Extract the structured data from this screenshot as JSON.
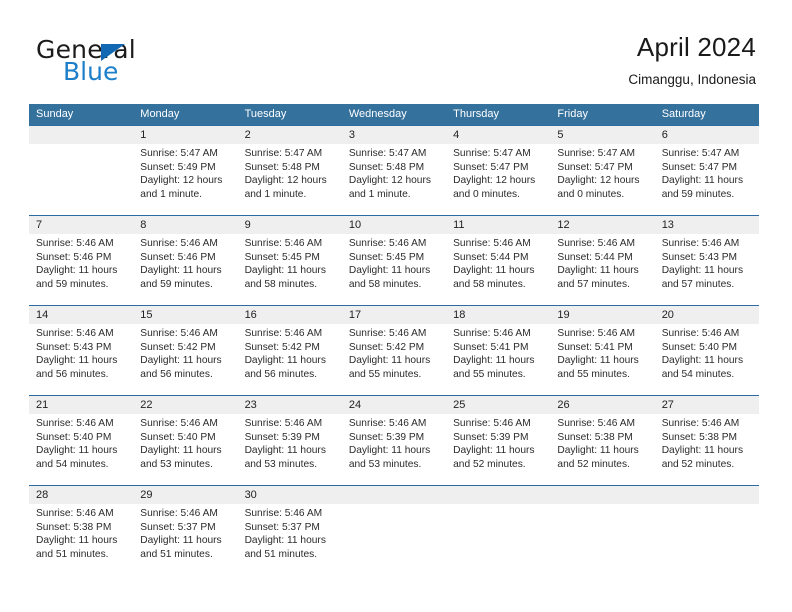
{
  "brand": {
    "word_general": "General",
    "word_blue": "Blue",
    "logo_icon": "triangle-logo-icon",
    "accent_color": "#1d7fc9"
  },
  "header": {
    "title": "April 2024",
    "subtitle": "Cimanggu, Indonesia"
  },
  "theme": {
    "header_bg": "#35719d",
    "row_divider": "#2d6ca2",
    "daynum_band": "#efefef"
  },
  "weekdays": [
    "Sunday",
    "Monday",
    "Tuesday",
    "Wednesday",
    "Thursday",
    "Friday",
    "Saturday"
  ],
  "weeks": [
    {
      "days": [
        {
          "num": "",
          "l1": "",
          "l2": "",
          "l3": "",
          "l4": ""
        },
        {
          "num": "1",
          "l1": "Sunrise: 5:47 AM",
          "l2": "Sunset: 5:49 PM",
          "l3": "Daylight: 12 hours",
          "l4": "and 1 minute."
        },
        {
          "num": "2",
          "l1": "Sunrise: 5:47 AM",
          "l2": "Sunset: 5:48 PM",
          "l3": "Daylight: 12 hours",
          "l4": "and 1 minute."
        },
        {
          "num": "3",
          "l1": "Sunrise: 5:47 AM",
          "l2": "Sunset: 5:48 PM",
          "l3": "Daylight: 12 hours",
          "l4": "and 1 minute."
        },
        {
          "num": "4",
          "l1": "Sunrise: 5:47 AM",
          "l2": "Sunset: 5:47 PM",
          "l3": "Daylight: 12 hours",
          "l4": "and 0 minutes."
        },
        {
          "num": "5",
          "l1": "Sunrise: 5:47 AM",
          "l2": "Sunset: 5:47 PM",
          "l3": "Daylight: 12 hours",
          "l4": "and 0 minutes."
        },
        {
          "num": "6",
          "l1": "Sunrise: 5:47 AM",
          "l2": "Sunset: 5:47 PM",
          "l3": "Daylight: 11 hours",
          "l4": "and 59 minutes."
        }
      ]
    },
    {
      "days": [
        {
          "num": "7",
          "l1": "Sunrise: 5:46 AM",
          "l2": "Sunset: 5:46 PM",
          "l3": "Daylight: 11 hours",
          "l4": "and 59 minutes."
        },
        {
          "num": "8",
          "l1": "Sunrise: 5:46 AM",
          "l2": "Sunset: 5:46 PM",
          "l3": "Daylight: 11 hours",
          "l4": "and 59 minutes."
        },
        {
          "num": "9",
          "l1": "Sunrise: 5:46 AM",
          "l2": "Sunset: 5:45 PM",
          "l3": "Daylight: 11 hours",
          "l4": "and 58 minutes."
        },
        {
          "num": "10",
          "l1": "Sunrise: 5:46 AM",
          "l2": "Sunset: 5:45 PM",
          "l3": "Daylight: 11 hours",
          "l4": "and 58 minutes."
        },
        {
          "num": "11",
          "l1": "Sunrise: 5:46 AM",
          "l2": "Sunset: 5:44 PM",
          "l3": "Daylight: 11 hours",
          "l4": "and 58 minutes."
        },
        {
          "num": "12",
          "l1": "Sunrise: 5:46 AM",
          "l2": "Sunset: 5:44 PM",
          "l3": "Daylight: 11 hours",
          "l4": "and 57 minutes."
        },
        {
          "num": "13",
          "l1": "Sunrise: 5:46 AM",
          "l2": "Sunset: 5:43 PM",
          "l3": "Daylight: 11 hours",
          "l4": "and 57 minutes."
        }
      ]
    },
    {
      "days": [
        {
          "num": "14",
          "l1": "Sunrise: 5:46 AM",
          "l2": "Sunset: 5:43 PM",
          "l3": "Daylight: 11 hours",
          "l4": "and 56 minutes."
        },
        {
          "num": "15",
          "l1": "Sunrise: 5:46 AM",
          "l2": "Sunset: 5:42 PM",
          "l3": "Daylight: 11 hours",
          "l4": "and 56 minutes."
        },
        {
          "num": "16",
          "l1": "Sunrise: 5:46 AM",
          "l2": "Sunset: 5:42 PM",
          "l3": "Daylight: 11 hours",
          "l4": "and 56 minutes."
        },
        {
          "num": "17",
          "l1": "Sunrise: 5:46 AM",
          "l2": "Sunset: 5:42 PM",
          "l3": "Daylight: 11 hours",
          "l4": "and 55 minutes."
        },
        {
          "num": "18",
          "l1": "Sunrise: 5:46 AM",
          "l2": "Sunset: 5:41 PM",
          "l3": "Daylight: 11 hours",
          "l4": "and 55 minutes."
        },
        {
          "num": "19",
          "l1": "Sunrise: 5:46 AM",
          "l2": "Sunset: 5:41 PM",
          "l3": "Daylight: 11 hours",
          "l4": "and 55 minutes."
        },
        {
          "num": "20",
          "l1": "Sunrise: 5:46 AM",
          "l2": "Sunset: 5:40 PM",
          "l3": "Daylight: 11 hours",
          "l4": "and 54 minutes."
        }
      ]
    },
    {
      "days": [
        {
          "num": "21",
          "l1": "Sunrise: 5:46 AM",
          "l2": "Sunset: 5:40 PM",
          "l3": "Daylight: 11 hours",
          "l4": "and 54 minutes."
        },
        {
          "num": "22",
          "l1": "Sunrise: 5:46 AM",
          "l2": "Sunset: 5:40 PM",
          "l3": "Daylight: 11 hours",
          "l4": "and 53 minutes."
        },
        {
          "num": "23",
          "l1": "Sunrise: 5:46 AM",
          "l2": "Sunset: 5:39 PM",
          "l3": "Daylight: 11 hours",
          "l4": "and 53 minutes."
        },
        {
          "num": "24",
          "l1": "Sunrise: 5:46 AM",
          "l2": "Sunset: 5:39 PM",
          "l3": "Daylight: 11 hours",
          "l4": "and 53 minutes."
        },
        {
          "num": "25",
          "l1": "Sunrise: 5:46 AM",
          "l2": "Sunset: 5:39 PM",
          "l3": "Daylight: 11 hours",
          "l4": "and 52 minutes."
        },
        {
          "num": "26",
          "l1": "Sunrise: 5:46 AM",
          "l2": "Sunset: 5:38 PM",
          "l3": "Daylight: 11 hours",
          "l4": "and 52 minutes."
        },
        {
          "num": "27",
          "l1": "Sunrise: 5:46 AM",
          "l2": "Sunset: 5:38 PM",
          "l3": "Daylight: 11 hours",
          "l4": "and 52 minutes."
        }
      ]
    },
    {
      "days": [
        {
          "num": "28",
          "l1": "Sunrise: 5:46 AM",
          "l2": "Sunset: 5:38 PM",
          "l3": "Daylight: 11 hours",
          "l4": "and 51 minutes."
        },
        {
          "num": "29",
          "l1": "Sunrise: 5:46 AM",
          "l2": "Sunset: 5:37 PM",
          "l3": "Daylight: 11 hours",
          "l4": "and 51 minutes."
        },
        {
          "num": "30",
          "l1": "Sunrise: 5:46 AM",
          "l2": "Sunset: 5:37 PM",
          "l3": "Daylight: 11 hours",
          "l4": "and 51 minutes."
        },
        {
          "num": "",
          "l1": "",
          "l2": "",
          "l3": "",
          "l4": ""
        },
        {
          "num": "",
          "l1": "",
          "l2": "",
          "l3": "",
          "l4": ""
        },
        {
          "num": "",
          "l1": "",
          "l2": "",
          "l3": "",
          "l4": ""
        },
        {
          "num": "",
          "l1": "",
          "l2": "",
          "l3": "",
          "l4": ""
        }
      ]
    }
  ]
}
